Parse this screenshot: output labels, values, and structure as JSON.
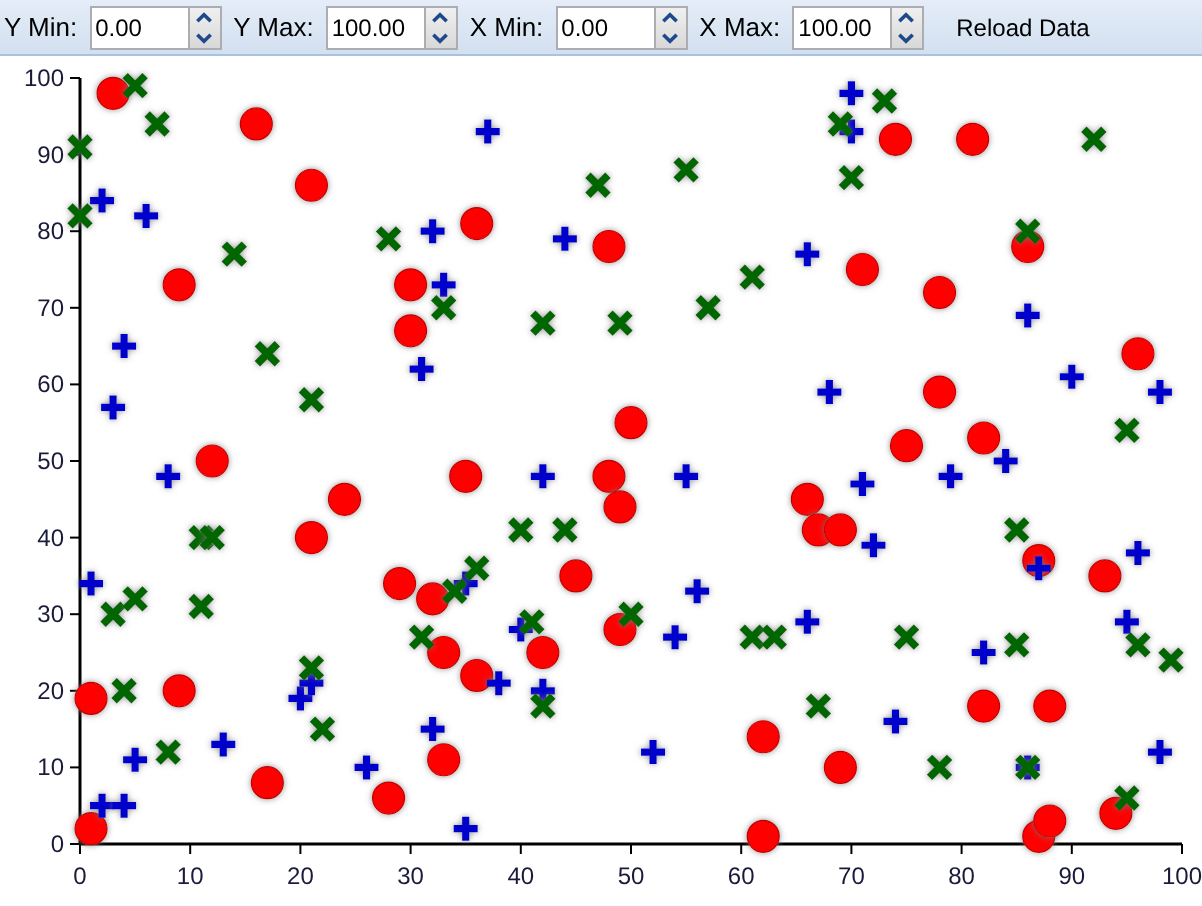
{
  "toolbar": {
    "fields": [
      {
        "label": "Y Min:",
        "value": "0.00"
      },
      {
        "label": "Y Max:",
        "value": "100.00"
      },
      {
        "label": "X Min:",
        "value": "0.00"
      },
      {
        "label": "X Max:",
        "value": "100.00"
      }
    ],
    "button": "Reload Data"
  },
  "chart": {
    "chart_data": {
      "type": "scatter",
      "xlim": [
        0,
        100
      ],
      "ylim": [
        0,
        100
      ],
      "xticks": [
        0,
        10,
        20,
        30,
        40,
        50,
        60,
        70,
        80,
        90,
        100
      ],
      "yticks": [
        0,
        10,
        20,
        30,
        40,
        50,
        60,
        70,
        80,
        90,
        100
      ],
      "series": [
        {
          "color": "#ff0000",
          "x": [
            3,
            16,
            21,
            9,
            36,
            30,
            30,
            48,
            12,
            35,
            48,
            24,
            74,
            81,
            86,
            71,
            78,
            96,
            78,
            50,
            75,
            82,
            21,
            29,
            32,
            33,
            36,
            33,
            28,
            17,
            9,
            1,
            1,
            42,
            45,
            49,
            49,
            66,
            67,
            69,
            87,
            93,
            82,
            88,
            62,
            69,
            62,
            87,
            88,
            94
          ],
          "values": [
            98,
            94,
            86,
            73,
            81,
            73,
            67,
            78,
            50,
            48,
            48,
            45,
            92,
            92,
            78,
            75,
            72,
            64,
            59,
            55,
            52,
            53,
            40,
            34,
            32,
            25,
            22,
            11,
            6,
            8,
            20,
            19,
            2,
            25,
            35,
            28,
            44,
            45,
            41,
            41,
            37,
            35,
            18,
            18,
            14,
            10,
            1,
            1,
            3,
            4
          ]
        },
        {
          "color": "#0000cc",
          "x": [
            2,
            6,
            4,
            3,
            8,
            37,
            32,
            33,
            31,
            44,
            42,
            70,
            70,
            66,
            86,
            90,
            98,
            68,
            55,
            71,
            79,
            84,
            1,
            2,
            4,
            5,
            13,
            20,
            21,
            26,
            32,
            35,
            35,
            40,
            38,
            42,
            87,
            96,
            56,
            54,
            66,
            82,
            95,
            74,
            52,
            86,
            98,
            72
          ],
          "values": [
            84,
            82,
            65,
            57,
            48,
            93,
            80,
            73,
            62,
            79,
            48,
            98,
            93,
            77,
            69,
            61,
            59,
            59,
            48,
            47,
            48,
            50,
            34,
            5,
            5,
            11,
            13,
            19,
            21,
            10,
            15,
            2,
            34,
            28,
            21,
            20,
            36,
            38,
            33,
            27,
            29,
            25,
            29,
            16,
            12,
            10,
            12,
            39
          ]
        },
        {
          "color": "#006600",
          "x": [
            5,
            7,
            0,
            0,
            14,
            17,
            21,
            28,
            33,
            47,
            42,
            73,
            69,
            70,
            92,
            86,
            61,
            57,
            49,
            55,
            95,
            11,
            12,
            11,
            3,
            5,
            4,
            8,
            21,
            22,
            31,
            34,
            36,
            40,
            44,
            41,
            42,
            85,
            50,
            61,
            63,
            75,
            85,
            96,
            99,
            67,
            78,
            86,
            95
          ],
          "values": [
            99,
            94,
            91,
            82,
            77,
            64,
            58,
            79,
            70,
            86,
            68,
            97,
            94,
            87,
            92,
            80,
            74,
            70,
            68,
            88,
            54,
            40,
            40,
            31,
            30,
            32,
            20,
            12,
            23,
            15,
            27,
            33,
            36,
            41,
            41,
            29,
            18,
            41,
            30,
            27,
            27,
            27,
            26,
            26,
            24,
            18,
            10,
            10,
            6
          ]
        }
      ]
    }
  }
}
